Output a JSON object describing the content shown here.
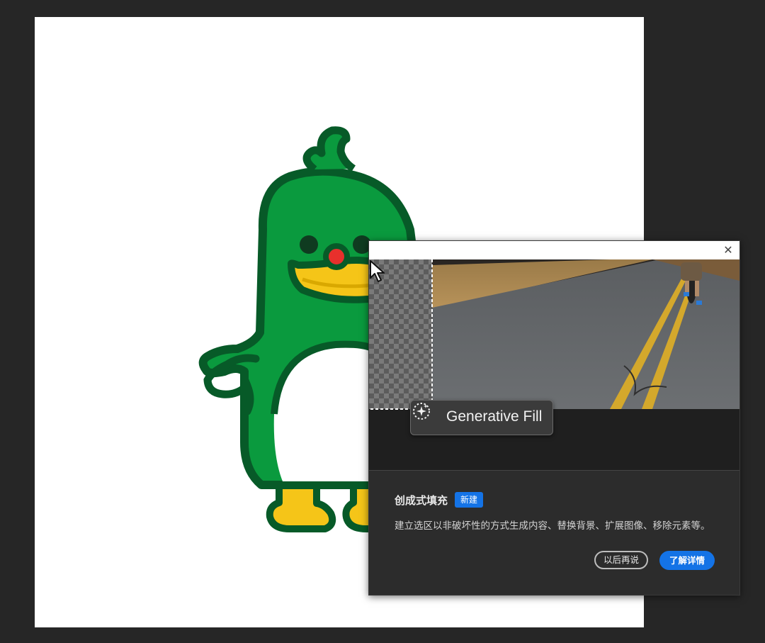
{
  "dialog": {
    "close_icon": "close-icon",
    "chip_label": "Generative Fill",
    "title": "创成式填充",
    "badge": "新建",
    "description": "建立选区以非破坏性的方式生成内容、替换背景、扩展图像、移除元素等。",
    "later_button": "以后再说",
    "learn_button": "了解详情"
  },
  "colors": {
    "accent": "#1473e6",
    "mascot_green": "#0a9a3e",
    "mascot_outline": "#075a28",
    "beak_yellow": "#f5c518",
    "nose_red": "#e8302c"
  }
}
